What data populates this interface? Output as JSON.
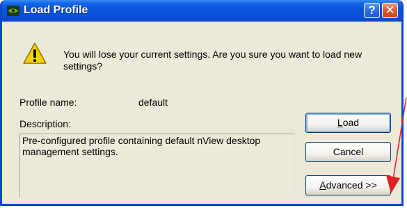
{
  "window": {
    "title": "Load Profile",
    "help_label": "?",
    "close_label": "✕"
  },
  "message": "You will lose your current settings. Are you sure you want to load new settings?",
  "profile": {
    "name_label": "Profile name:",
    "name_value": "default",
    "description_label": "Description:",
    "description_value": "Pre-configured profile containing default nView desktop management settings."
  },
  "buttons": {
    "load": {
      "mnemonic": "L",
      "rest": "oad"
    },
    "cancel": {
      "label": "Cancel"
    },
    "advanced": {
      "mnemonic": "A",
      "rest": "dvanced >>"
    }
  },
  "colors": {
    "titlebar": "#0a50d8",
    "dialog_bg": "#ece9d8",
    "annotation_arrow": "#e02020"
  },
  "icons": {
    "title": "nvidia-eye-icon",
    "warning": "warning-triangle-icon"
  }
}
